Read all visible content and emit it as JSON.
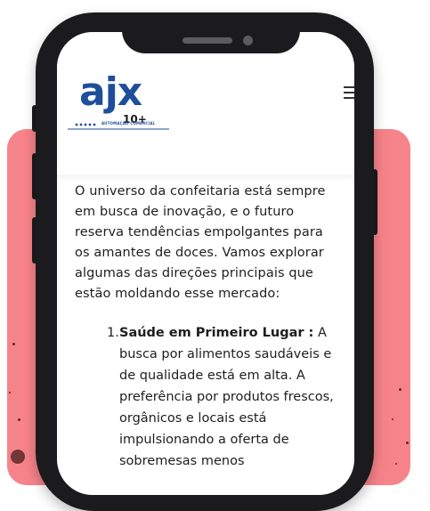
{
  "logo": {
    "text": "ajx",
    "badge": "10+",
    "tagline": "AUTOMAÇÃO COMERCIAL"
  },
  "menu": {
    "icon": "hamburger-icon"
  },
  "article": {
    "intro": "O universo da confeitaria está sempre em busca de inovação, e o futuro reserva tendências empolgantes para os amantes de doces. Vamos explorar algumas das direções principais que estão moldando esse mercado:",
    "items": [
      {
        "number": "1.",
        "title": "Saúde em Primeiro Lugar :",
        "text": "A busca por alimentos saudáveis e de qualidade está em alta. A preferência por produtos frescos, orgânicos e locais está impulsionando a oferta de sobremesas menos"
      }
    ]
  },
  "colors": {
    "brand_blue": "#1f4e9a",
    "backdrop": "#f7838a",
    "phone": "#1b1b1d"
  }
}
